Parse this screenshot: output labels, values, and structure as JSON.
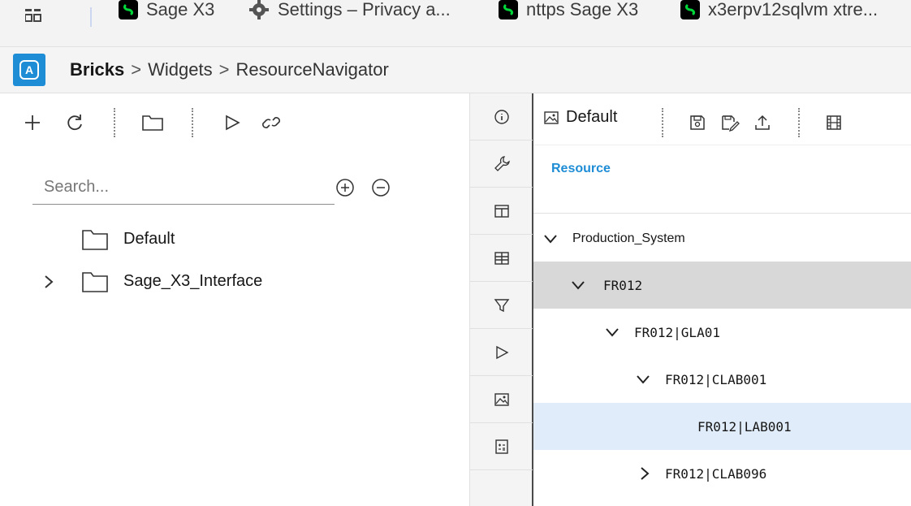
{
  "browser": {
    "tabs": [
      {
        "label": "Sage X3",
        "icon": "sage-icon"
      },
      {
        "label": "Settings – Privacy a...",
        "icon": "gear-icon"
      },
      {
        "label": "nttps Sage X3",
        "icon": "sage-icon"
      },
      {
        "label": "x3erpv12sqlvm xtre...",
        "icon": "sage-icon"
      }
    ]
  },
  "header": {
    "root": "Bricks",
    "sep": ">",
    "crumb1": "Widgets",
    "crumb2": "ResourceNavigator",
    "logo_letter": "A",
    "accent": "#1f8dd6"
  },
  "left": {
    "search_placeholder": "Search...",
    "tree": [
      {
        "label": "Default",
        "expandable": false
      },
      {
        "label": "Sage_X3_Interface",
        "expandable": true
      }
    ]
  },
  "rail": {
    "icons": [
      "info-icon",
      "wrench-icon",
      "layout-icon",
      "table-icon",
      "filter-icon",
      "play-icon",
      "image-icon",
      "calculator-icon"
    ]
  },
  "right": {
    "view_label": "Default",
    "tab_resource": "Resource",
    "rows": [
      {
        "label": "Production_System",
        "state": "expanded"
      },
      {
        "label": "FR012",
        "state": "expanded"
      },
      {
        "label": "FR012|GLA01",
        "state": "expanded"
      },
      {
        "label": "FR012|CLAB001",
        "state": "expanded"
      },
      {
        "label": "FR012|LAB001",
        "state": "leaf"
      },
      {
        "label": "FR012|CLAB096",
        "state": "collapsed"
      }
    ]
  }
}
